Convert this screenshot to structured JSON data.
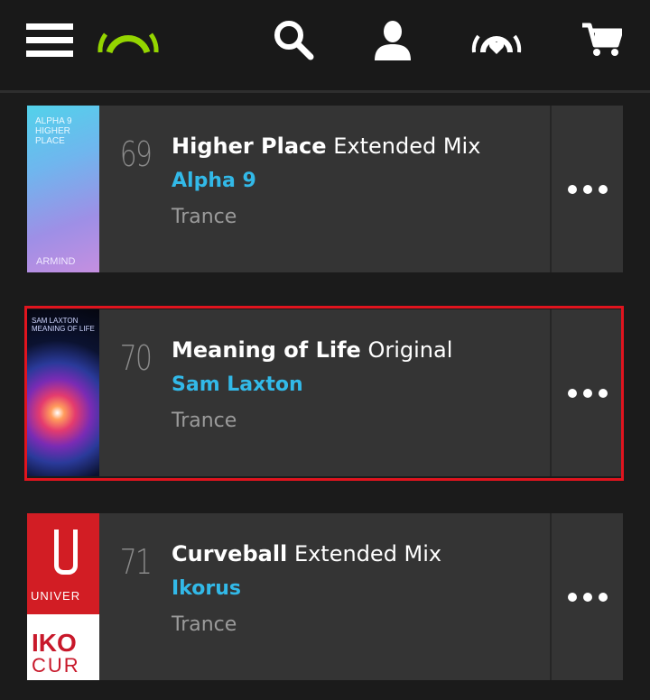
{
  "header": {
    "icons": [
      "menu-icon",
      "beatport-logo-icon",
      "search-icon",
      "account-icon",
      "mybeatport-icon",
      "cart-icon"
    ],
    "colors": {
      "logo": "#94d500",
      "icons": "#ffffff"
    }
  },
  "tracks": [
    {
      "rank": "69",
      "title": "Higher Place",
      "mix": "Extended Mix",
      "artist": "Alpha 9",
      "genre": "Trance",
      "art_text": [
        "ALPHA 9",
        "HIGHER PLACE"
      ],
      "art_label": "ARMIND"
    },
    {
      "rank": "70",
      "title": "Meaning of Life",
      "mix": "Original",
      "artist": "Sam Laxton",
      "genre": "Trance",
      "art_text": [
        "SAM LAXTON",
        "MEANING OF LIFE"
      ],
      "highlighted": true
    },
    {
      "rank": "71",
      "title": "Curveball",
      "mix": "Extended Mix",
      "artist": "Ikorus",
      "genre": "Trance",
      "art_text": [
        "UNIVER",
        "IKO",
        "CUR"
      ]
    }
  ],
  "colors": {
    "artist": "#32b9e8",
    "highlight": "#e0141e",
    "row_bg": "#343434"
  }
}
